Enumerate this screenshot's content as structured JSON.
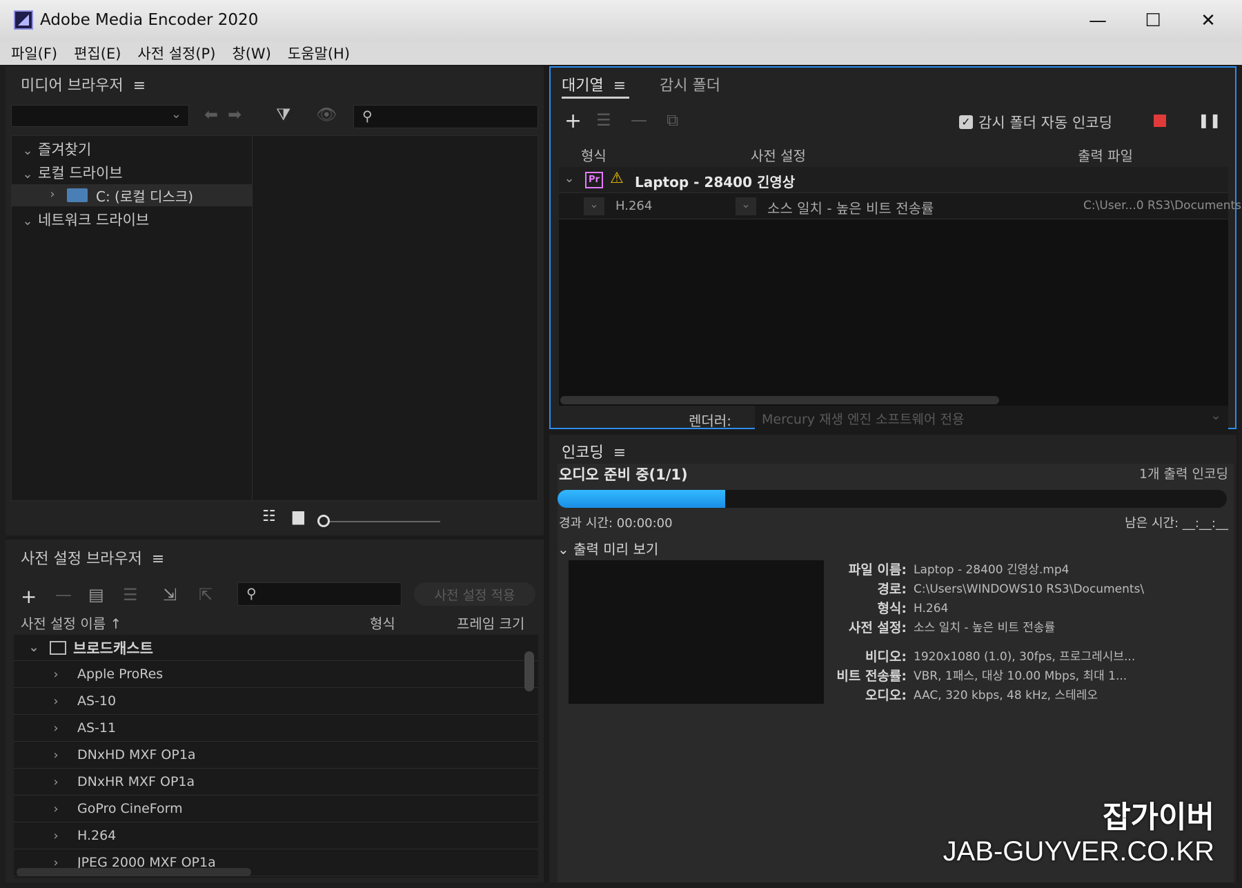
{
  "app": {
    "title": "Adobe Media Encoder 2020"
  },
  "window_controls": {
    "minimize": "—",
    "maximize": "☐",
    "close": "✕"
  },
  "menu": [
    "파일(F)",
    "편집(E)",
    "사전 설정(P)",
    "창(W)",
    "도움말(H)"
  ],
  "media_browser": {
    "title": "미디어 브라우저",
    "tree": [
      {
        "label": "즐겨찾기",
        "expanded": true
      },
      {
        "label": "로컬 드라이브",
        "expanded": true
      },
      {
        "label": "C: (로컬 디스크)",
        "child": true
      },
      {
        "label": "네트워크 드라이브",
        "expanded": true
      }
    ]
  },
  "queue": {
    "tabs": [
      "대기열",
      "감시 폴더"
    ],
    "auto_encode_label": "감시 폴더 자동 인코딩",
    "auto_encode_checked": true,
    "columns": [
      "형식",
      "사전 설정",
      "출력 파일"
    ],
    "item": {
      "badge": "Pr",
      "name": "Laptop - 28400 긴영상"
    },
    "output": {
      "format": "H.264",
      "preset": "소스 일치 - 높은 비트 전송률",
      "file": "C:\\User...0 RS3\\Documents"
    },
    "renderer_label": "렌더러:",
    "renderer_value": "Mercury 재생 엔진 소프트웨어 전용"
  },
  "encoding": {
    "title": "인코딩",
    "status": "오디오 준비 중(1/1)",
    "output_count": "1개 출력 인코딩",
    "progress": 0.25,
    "elapsed": "경과 시간: 00:00:00",
    "remaining": "남은 시간: __:__:__",
    "preview_label": "출력 미리 보기",
    "info": [
      {
        "key": "파일 이름:",
        "value": "Laptop - 28400 긴영상.mp4"
      },
      {
        "key": "경로:",
        "value": "C:\\Users\\WINDOWS10 RS3\\Documents\\"
      },
      {
        "key": "형식:",
        "value": "H.264"
      },
      {
        "key": "사전 설정:",
        "value": "소스 일치 - 높은 비트 전송률"
      },
      {
        "key": "비디오:",
        "value": "1920x1080 (1.0), 30fps, 프로그레시브..."
      },
      {
        "key": "비트 전송률:",
        "value": "VBR, 1패스, 대상 10.00 Mbps, 최대 1..."
      },
      {
        "key": "오디오:",
        "value": "AAC, 320 kbps, 48 kHz, 스테레오"
      }
    ]
  },
  "preset_browser": {
    "title": "사전 설정 브라우저",
    "apply_label": "사전 설정 적용",
    "columns": {
      "name": "사전 설정 이름",
      "format": "형식",
      "frame": "프레임 크기"
    },
    "group": "브로드캐스트",
    "items": [
      "Apple ProRes",
      "AS-10",
      "AS-11",
      "DNxHD MXF OP1a",
      "DNxHR MXF OP1a",
      "GoPro CineForm",
      "H.264",
      "JPEG 2000 MXF OP1a"
    ]
  },
  "watermark": {
    "line1": "잡가이버",
    "line2": "JAB-GUYVER.CO.KR"
  },
  "colors": {
    "accent": "#1b9df0",
    "highlight": "#2d8cf0",
    "stop": "#e03a3a"
  }
}
